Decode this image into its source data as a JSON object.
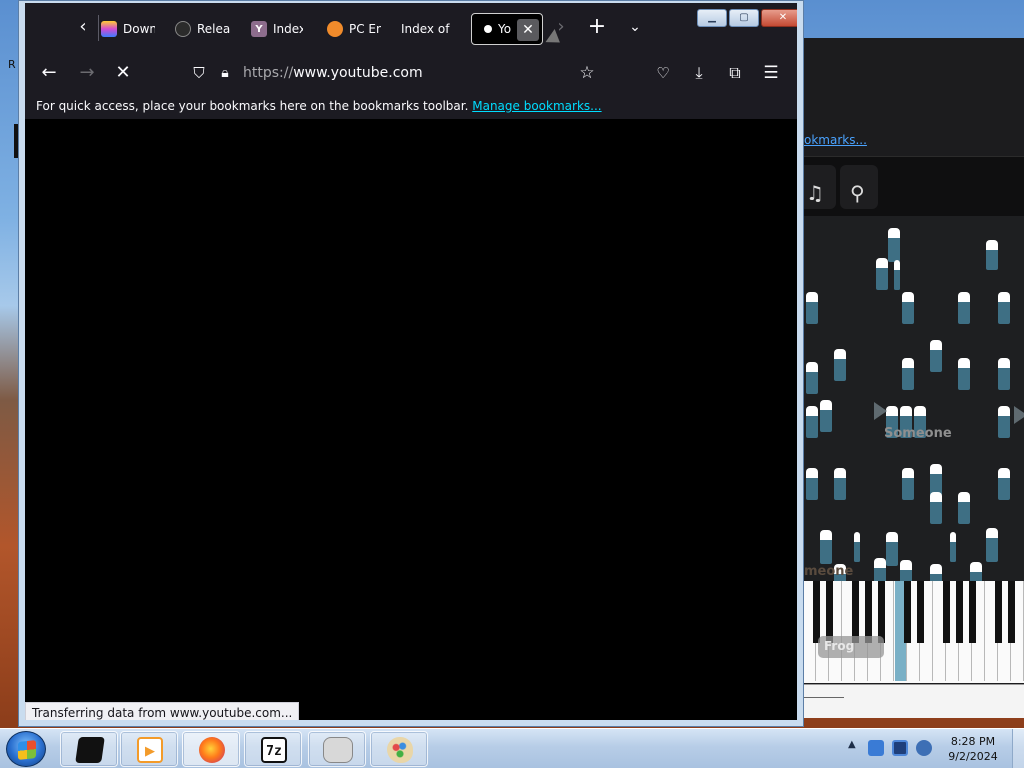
{
  "desktop": {
    "partial_label": "R"
  },
  "browser": {
    "tabs": [
      {
        "label": "Down",
        "favicon": "colorful-stack-icon",
        "color": "#7a4bd1"
      },
      {
        "label": "Relea",
        "favicon": "github-icon",
        "color": "#2b2b2b"
      },
      {
        "label": "Index",
        "favicon": "y-letter-icon",
        "color": "#8d6d8d"
      },
      {
        "label": "PC En",
        "favicon": "orange-disc-icon",
        "color": "#f08b2b"
      },
      {
        "label": "Index of /",
        "favicon": "",
        "color": ""
      },
      {
        "label": "Yo",
        "favicon": "dot-icon",
        "color": "#ffffff",
        "active": true
      }
    ],
    "url": {
      "scheme": "https://",
      "host": "www.youtube.com",
      "rest": ""
    },
    "bookmarks_bar": {
      "message": "For quick access, place your bookmarks here on the bookmarks toolbar.",
      "link": "Manage bookmarks..."
    },
    "status_text": "Transferring data from www.youtube.com..."
  },
  "background_app": {
    "bookmarks_link_partial": "okmarks...",
    "player_names": [
      "Someone",
      "meone",
      "Frog"
    ],
    "tag_label": "Frog"
  },
  "taskbar": {
    "time": "8:28 PM",
    "date": "9/2/2024",
    "apps": [
      {
        "name": "black-window-app",
        "glyph": "",
        "color": "#111111"
      },
      {
        "name": "media-player-app",
        "glyph": "▶",
        "color": "#f39b2a"
      },
      {
        "name": "firefox-app",
        "glyph": "",
        "color": "#ff6d1f",
        "active": true
      },
      {
        "name": "7zip-app",
        "glyph": "7z",
        "color": "#ffffff"
      },
      {
        "name": "gamepad-app",
        "glyph": "",
        "color": "#d8d8d8"
      },
      {
        "name": "paint-app",
        "glyph": "",
        "color": "#e9d6a8"
      }
    ]
  }
}
